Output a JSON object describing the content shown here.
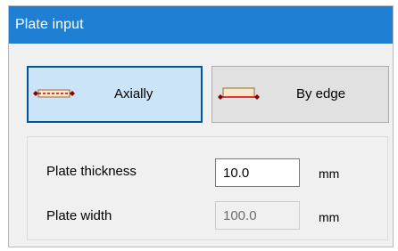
{
  "header": {
    "title": "Plate input"
  },
  "modes": {
    "axially": {
      "label": "Axially",
      "icon": "plate-axial-icon",
      "selected": true
    },
    "by_edge": {
      "label": "By edge",
      "icon": "plate-edge-icon",
      "selected": false
    }
  },
  "fields": {
    "plate_thickness": {
      "label": "Plate thickness",
      "value": "10.0",
      "unit": "mm",
      "enabled": true
    },
    "plate_width": {
      "label": "Plate width",
      "value": "100.0",
      "unit": "mm",
      "enabled": false
    }
  },
  "colors": {
    "header": "#1e7fd3",
    "selected_button_bg": "#cce4f7",
    "selected_button_border": "#005499",
    "icon_plate_fill": "#f5e6cc",
    "icon_plate_stroke": "#9b6b2e",
    "icon_line_red": "#d40000"
  }
}
